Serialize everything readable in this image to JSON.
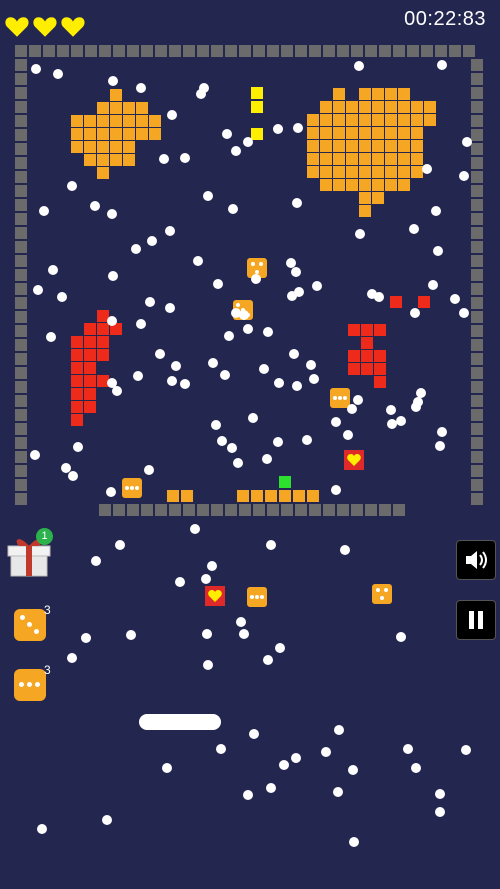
{
  "hud": {
    "lives": 3,
    "timer": "00:22:83"
  },
  "powerups": [
    {
      "name": "gift",
      "badge": "1"
    },
    {
      "name": "triple-dot-dice-a",
      "count": "3"
    },
    {
      "name": "triple-dot-dice-b",
      "count": "3"
    }
  ],
  "controls": {
    "sound_icon": "speaker-icon",
    "pause_icon": "pause-icon"
  },
  "colors": {
    "background": "#23264e",
    "wall": "#6b6b6b",
    "orange_brick": "#f5a623",
    "red_brick": "#ee2a1a",
    "yellow_brick": "#ffee00",
    "green_brick": "#2ee02e",
    "heart": "#ffee00",
    "ball": "#ffffff"
  }
}
